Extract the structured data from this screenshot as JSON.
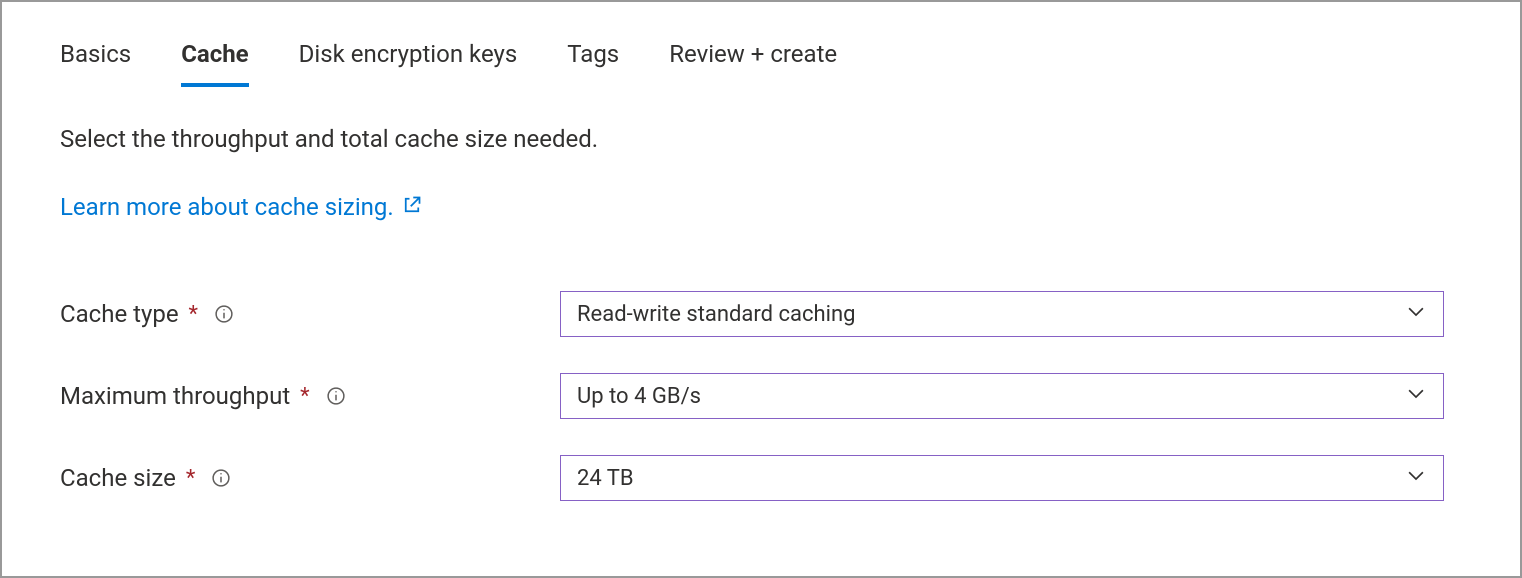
{
  "tabs": {
    "basics": "Basics",
    "cache": "Cache",
    "disk_encryption_keys": "Disk encryption keys",
    "tags": "Tags",
    "review_create": "Review + create"
  },
  "description": "Select the throughput and total cache size needed.",
  "learn_more": "Learn more about cache sizing.",
  "fields": {
    "cache_type": {
      "label": "Cache type",
      "value": "Read-write standard caching"
    },
    "max_throughput": {
      "label": "Maximum throughput",
      "value": "Up to 4 GB/s"
    },
    "cache_size": {
      "label": "Cache size",
      "value": "24 TB"
    }
  },
  "required_marker": "*",
  "colors": {
    "link": "#0078d4",
    "tab_underline": "#0078d4",
    "select_border": "#8661c5",
    "required": "#a4262c"
  }
}
